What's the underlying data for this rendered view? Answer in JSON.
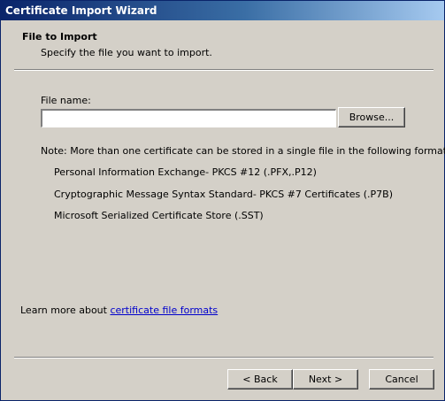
{
  "window": {
    "title": "Certificate Import Wizard"
  },
  "header": {
    "title": "File to Import",
    "subtitle": "Specify the file you want to import."
  },
  "file": {
    "label": "File name:",
    "value": "",
    "browse_label": "Browse..."
  },
  "note": {
    "text": "Note:  More than one certificate can be stored in a single file in the following formats:",
    "formats": [
      "Personal Information Exchange- PKCS #12 (.PFX,.P12)",
      "Cryptographic Message Syntax Standard- PKCS #7 Certificates (.P7B)",
      "Microsoft Serialized Certificate Store (.SST)"
    ]
  },
  "learn_more": {
    "prefix": "Learn more about ",
    "link_text": "certificate file formats"
  },
  "footer": {
    "back_label": "< Back",
    "next_label": "Next >",
    "cancel_label": "Cancel"
  }
}
